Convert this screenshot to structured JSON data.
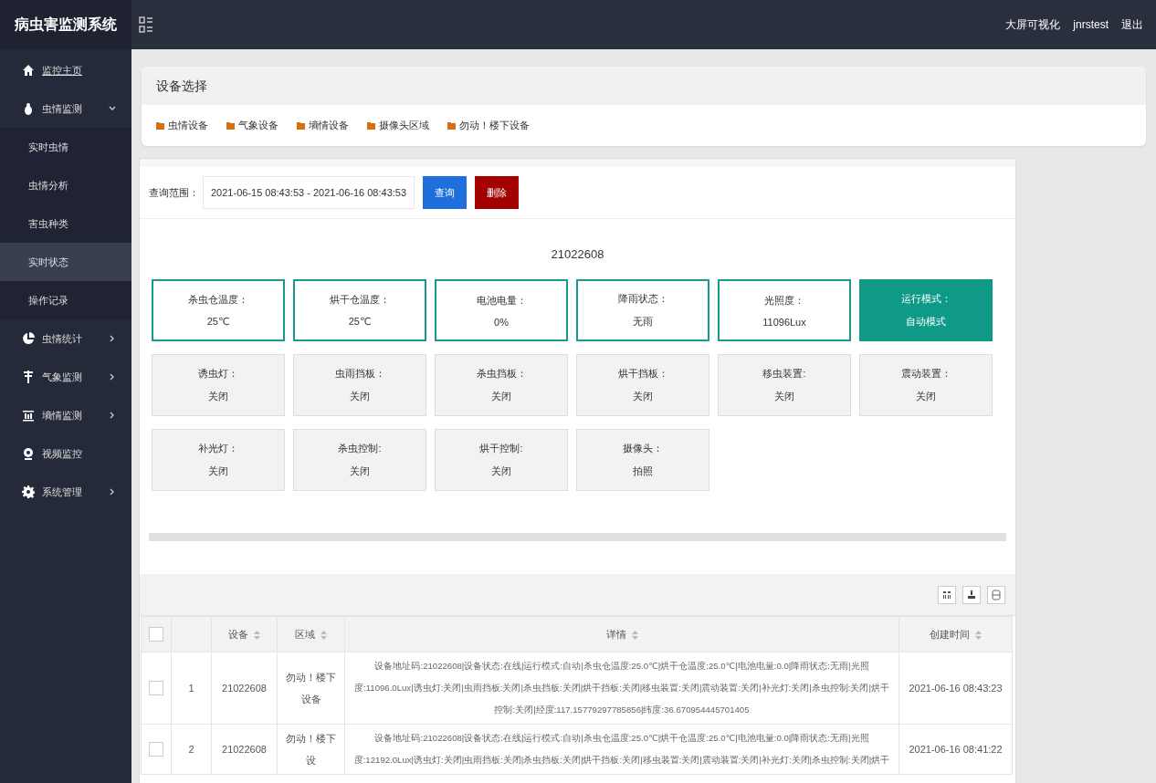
{
  "app_title": "病虫害监测系统",
  "header_links": [
    "大屏可视化",
    "jnrstest",
    "退出"
  ],
  "sidebar": {
    "items": [
      {
        "label": "监控主页",
        "selected": false
      },
      {
        "label": "虫情监测",
        "expanded": true,
        "selected": false,
        "children": [
          {
            "label": "实时虫情",
            "selected": false
          },
          {
            "label": "虫情分析",
            "selected": false
          },
          {
            "label": "害虫种类",
            "selected": false
          },
          {
            "label": "实时状态",
            "selected": true
          },
          {
            "label": "操作记录",
            "selected": false
          }
        ]
      },
      {
        "label": "虫情统计",
        "expanded": false,
        "selected": false
      },
      {
        "label": "气象监测",
        "expanded": false,
        "selected": false
      },
      {
        "label": "墒情监测",
        "expanded": false,
        "selected": false
      },
      {
        "label": "视频监控",
        "selected": false
      },
      {
        "label": "系统管理",
        "expanded": false,
        "selected": false
      }
    ]
  },
  "device_select": {
    "title": "设备选择",
    "groups": [
      "虫情设备",
      "气象设备",
      "墒情设备",
      "摄像头区域",
      "勿动！楼下设备"
    ]
  },
  "query": {
    "label": "查询范围：",
    "range": "2021-06-15 08:43:53 - 2021-06-16 08:43:53",
    "buttons": [
      {
        "label": "查询",
        "kind": "primary"
      },
      {
        "label": "删除",
        "kind": "danger"
      }
    ]
  },
  "device_id": "21022608",
  "status_cards": [
    {
      "label": "杀虫仓温度：",
      "value": "25℃",
      "kind": "reading"
    },
    {
      "label": "烘干仓温度：",
      "value": "25℃",
      "kind": "reading"
    },
    {
      "label": "电池电量：",
      "value": "0%",
      "kind": "reading"
    },
    {
      "label": "降雨状态：",
      "value": "无雨",
      "kind": "reading"
    },
    {
      "label": "光照度：",
      "value": "11096Lux",
      "kind": "reading"
    },
    {
      "label": "运行模式：",
      "value": "自动模式",
      "kind": "mode"
    },
    {
      "label": "诱虫灯：",
      "value": "关闭",
      "kind": "switch"
    },
    {
      "label": "虫雨挡板：",
      "value": "关闭",
      "kind": "switch"
    },
    {
      "label": "杀虫挡板：",
      "value": "关闭",
      "kind": "switch"
    },
    {
      "label": "烘干挡板：",
      "value": "关闭",
      "kind": "switch"
    },
    {
      "label": "移虫装置:",
      "value": "关闭",
      "kind": "switch"
    },
    {
      "label": "震动装置：",
      "value": "关闭",
      "kind": "switch"
    },
    {
      "label": "补光灯：",
      "value": "关闭",
      "kind": "switch"
    },
    {
      "label": "杀虫控制:",
      "value": "关闭",
      "kind": "switch"
    },
    {
      "label": "烘干控制:",
      "value": "关闭",
      "kind": "switch"
    },
    {
      "label": "摄像头：",
      "value": "拍照",
      "kind": "switch"
    }
  ],
  "table": {
    "header_checked": false,
    "columns": [
      "设备",
      "区域",
      "详情",
      "创建时间"
    ],
    "rows": [
      {
        "checked": false,
        "index": "1",
        "device": "21022608",
        "area": "勿动！楼下设备",
        "detail": "设备地址码:21022608|设备状态:在线|运行模式:自动|杀虫仓温度:25.0℃|烘干仓温度:25.0℃|电池电量:0.0|降雨状态:无雨|光照度:11096.0Lux|诱虫灯:关闭|虫雨挡板:关闭|杀虫挡板:关闭|烘干挡板:关闭|移虫装置:关闭|震动装置:关闭|补光灯:关闭|杀虫控制:关闭|烘干控制:关闭|经度:117.15779297785856|纬度:36.670954445701405",
        "time": "2021-06-16 08:43:23"
      },
      {
        "checked": false,
        "index": "2",
        "device": "21022608",
        "area": "勿动！楼下设",
        "detail": "设备地址码:21022608|设备状态:在线|运行模式:自动|杀虫仓温度:25.0℃|烘干仓温度:25.0℃|电池电量:0.0|降雨状态:无雨|光照度:12192.0Lux|诱虫灯:关闭|虫雨挡板:关闭|杀虫挡板:关闭|烘干挡板:关闭|移虫装置:关闭|震动装置:关闭|补光灯:关闭|杀虫控制:关闭|烘干",
        "time": "2021-06-16 08:41:22"
      }
    ]
  }
}
